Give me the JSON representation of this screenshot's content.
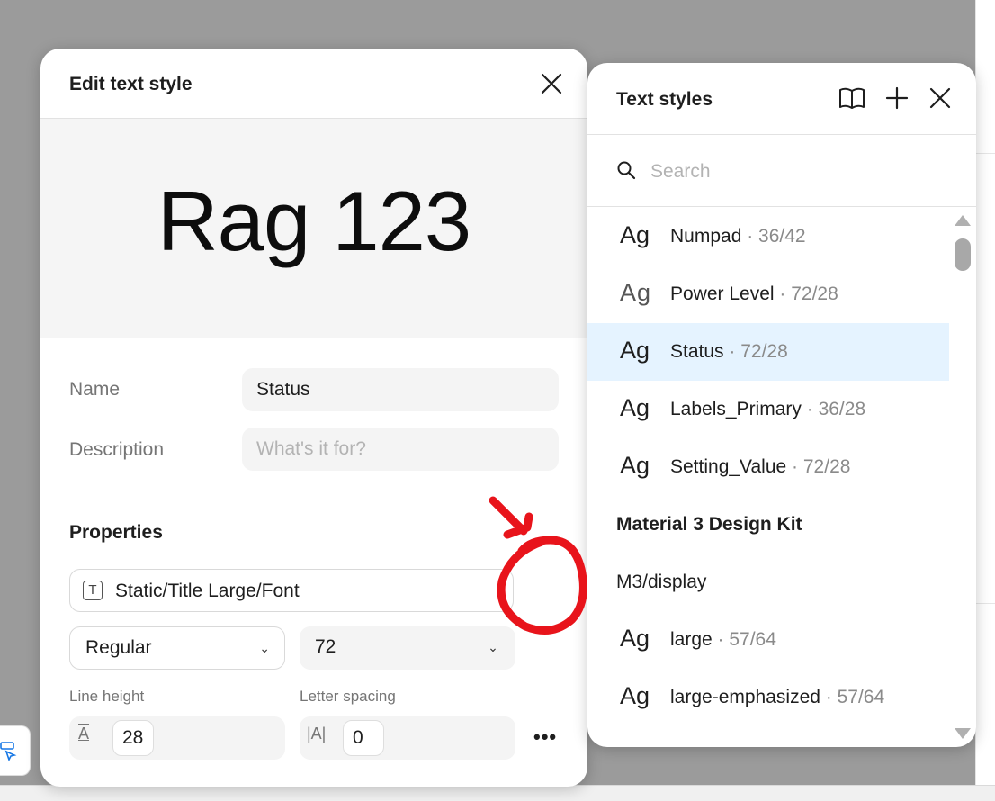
{
  "edit_panel": {
    "title": "Edit text style",
    "preview_text": "Rag 123",
    "name_label": "Name",
    "name_value": "Status",
    "description_label": "Description",
    "description_placeholder": "What's it for?",
    "properties_title": "Properties",
    "font_style": "Static/Title Large/Font",
    "weight": "Regular",
    "size": "72",
    "line_height_label": "Line height",
    "line_height_value": "28",
    "letter_spacing_label": "Letter spacing",
    "letter_spacing_value": "0",
    "line_height_glyph": "A",
    "letter_spacing_glyph": "|A|",
    "font_glyph": "T"
  },
  "styles_panel": {
    "title": "Text styles",
    "search_placeholder": "Search",
    "items": [
      {
        "kind": "style",
        "ag": "Ag",
        "name": "Numpad",
        "meta": " · 36/42",
        "selected": false
      },
      {
        "kind": "style",
        "ag": "Ag",
        "name": "Power Level",
        "meta": " · 72/28",
        "selected": false
      },
      {
        "kind": "style",
        "ag": "Ag",
        "name": "Status",
        "meta": " · 72/28",
        "selected": true
      },
      {
        "kind": "style",
        "ag": "Ag",
        "name": "Labels_Primary",
        "meta": " · 36/28",
        "selected": false
      },
      {
        "kind": "style",
        "ag": "Ag",
        "name": "Setting_Value",
        "meta": " · 72/28",
        "selected": false
      },
      {
        "kind": "group",
        "name": "Material 3 Design Kit"
      },
      {
        "kind": "subgroup",
        "name": "M3/display"
      },
      {
        "kind": "style",
        "ag": "Ag",
        "name": "large",
        "meta": " · 57/64",
        "selected": false
      },
      {
        "kind": "style",
        "ag": "Ag",
        "name": "large-emphasized",
        "meta": " · 57/64",
        "selected": false
      }
    ]
  },
  "colors": {
    "selected_row": "#e5f3ff",
    "annotation": "#e8141b",
    "canvas": "#9b9b9b"
  },
  "icons": [
    "close-icon",
    "library-book-icon",
    "plus-icon",
    "search-icon",
    "text-type-icon",
    "chevron-down-icon",
    "more-icon"
  ]
}
